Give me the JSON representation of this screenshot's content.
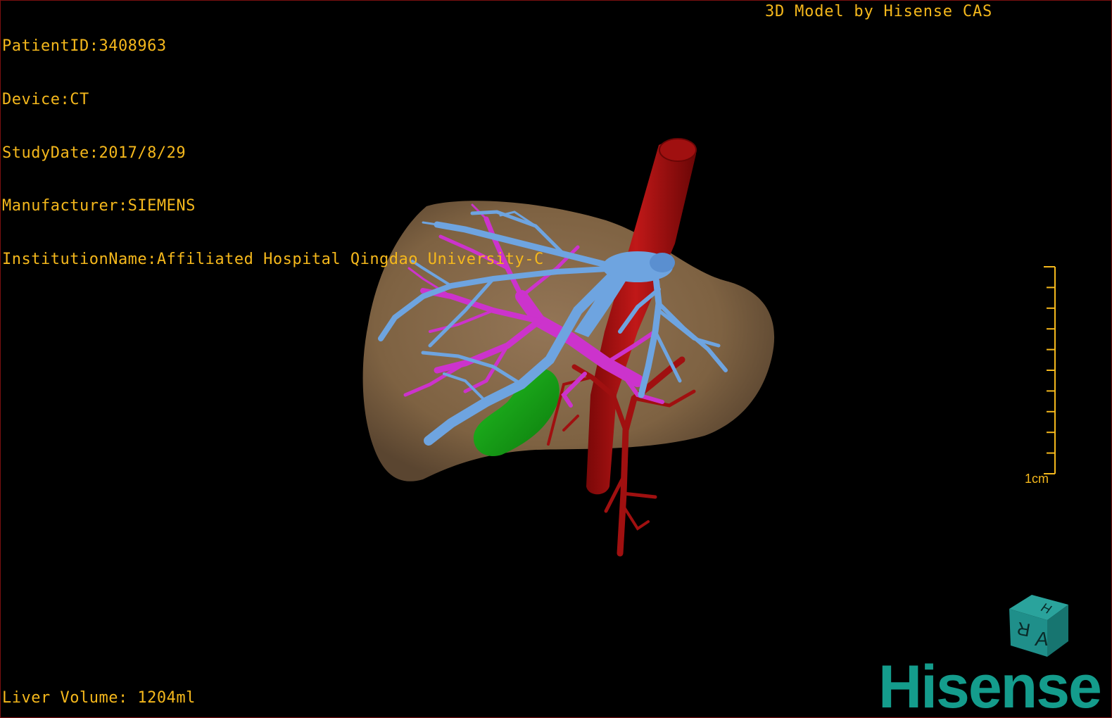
{
  "overlay": {
    "patient_id": "PatientID:3408963",
    "device": "Device:CT",
    "study_date": "StudyDate:2017/8/29",
    "manufacturer": "Manufacturer:SIEMENS",
    "institution": "InstitutionName:Affiliated Hospital Qingdao University-C",
    "credit": "3D Model by Hisense CAS",
    "liver_volume": "Liver Volume: 1204ml"
  },
  "scale_bar": {
    "label": "1cm",
    "ticks": 10
  },
  "orientation_cube": {
    "faces": [
      "H",
      "R",
      "A"
    ],
    "color": "#1f8f8a"
  },
  "logo": {
    "text": "Hisense",
    "color": "#149c8c"
  },
  "colors": {
    "overlay_text": "#f5b81c",
    "liver": "#8a6c4a",
    "hepatic_vein": "#6ea4e0",
    "portal_vein": "#cc33cc",
    "artery": "#b01010",
    "gallbladder": "#18a818"
  }
}
